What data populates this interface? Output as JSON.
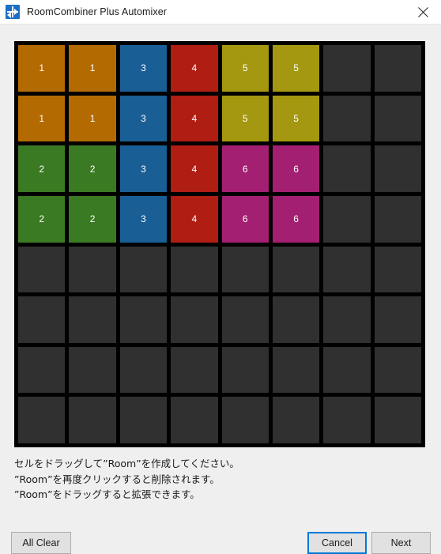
{
  "window": {
    "title": "RoomCombiner Plus Automixer",
    "icon": "room-combiner-icon",
    "close_label": "✕"
  },
  "grid": {
    "columns": 8,
    "rows": 8,
    "empty_color": "#303030",
    "gap_color": "#000000",
    "room_colors": {
      "1": "#b36a00",
      "2": "#3a7a22",
      "3": "#1a5e96",
      "4": "#b01d12",
      "5": "#a39810",
      "6": "#a31f72"
    },
    "cells": [
      [
        "1",
        "1",
        "3",
        "4",
        "5",
        "5",
        "",
        ""
      ],
      [
        "1",
        "1",
        "3",
        "4",
        "5",
        "5",
        "",
        ""
      ],
      [
        "2",
        "2",
        "3",
        "4",
        "6",
        "6",
        "",
        ""
      ],
      [
        "2",
        "2",
        "3",
        "4",
        "6",
        "6",
        "",
        ""
      ],
      [
        "",
        "",
        "",
        "",
        "",
        "",
        "",
        ""
      ],
      [
        "",
        "",
        "",
        "",
        "",
        "",
        "",
        ""
      ],
      [
        "",
        "",
        "",
        "",
        "",
        "",
        "",
        ""
      ],
      [
        "",
        "",
        "",
        "",
        "",
        "",
        "",
        ""
      ]
    ]
  },
  "hints": [
    "セルをドラッグして”Room”を作成してください。",
    "”Room”を再度クリックすると削除されます。",
    "”Room”をドラッグすると拡張できます。"
  ],
  "buttons": {
    "all_clear": "All Clear",
    "cancel": "Cancel",
    "next": "Next",
    "focus_color": "#0078d7"
  }
}
